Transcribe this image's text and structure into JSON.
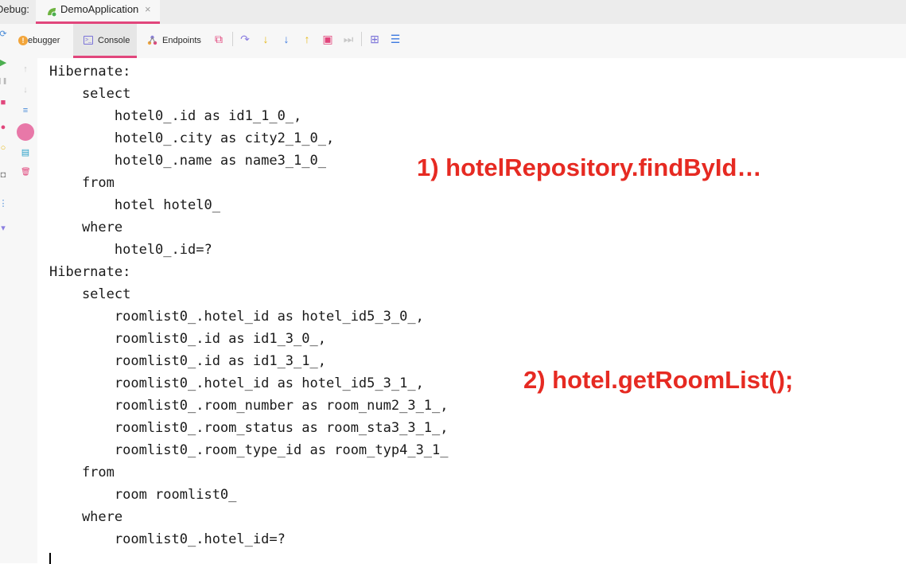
{
  "tabbar": {
    "debug_label": "Debug:",
    "run_tab_title": "DemoApplication",
    "close_glyph": "×",
    "accent_color": "#e1467c"
  },
  "toolbar": {
    "tabs": [
      {
        "label": "Debugger",
        "icon": "debugger-icon",
        "ic_text": "!",
        "rest_text": "ebugger"
      },
      {
        "label": "Console",
        "icon": "console-icon",
        "ic_text": ">_"
      },
      {
        "label": "Endpoints",
        "icon": "endpoints-icon"
      }
    ],
    "buttons": [
      {
        "icon": "restore-layout-icon",
        "glyph": "⧉",
        "color": "#e1467c"
      },
      {
        "icon": "step-over-icon",
        "glyph": "↷",
        "color": "#8b7ee0"
      },
      {
        "icon": "step-into-icon",
        "glyph": "↓",
        "color": "#e5b91a"
      },
      {
        "icon": "force-step-into-icon",
        "glyph": "↓",
        "color": "#3d7ae0"
      },
      {
        "icon": "step-out-icon",
        "glyph": "↑",
        "color": "#e5b91a"
      },
      {
        "icon": "drop-frame-icon",
        "glyph": "▣",
        "color": "#e1467c"
      },
      {
        "icon": "run-to-cursor-icon",
        "glyph": "⏭",
        "color": "#c8c8c8"
      },
      {
        "icon": "evaluate-expression-icon",
        "glyph": "⊞",
        "color": "#7a72d8"
      },
      {
        "icon": "trace-icon",
        "glyph": "☰",
        "color": "#3d7ae0"
      }
    ]
  },
  "gutter": {
    "left": [
      {
        "icon": "rerun-icon",
        "glyph": "⟳",
        "color": "#4a8cd8"
      },
      {
        "icon": "resume-icon",
        "glyph": "▶",
        "color": "#4caf50"
      },
      {
        "icon": "pause-icon",
        "glyph": "❚❚",
        "color": "#b9b9b9"
      },
      {
        "icon": "stop-icon",
        "glyph": "■",
        "color": "#e1467c"
      },
      {
        "icon": "breakpoints-icon",
        "glyph": "●",
        "color": "#e1467c"
      },
      {
        "icon": "mute-breakpoints-icon",
        "glyph": "○",
        "color": "#e5b91a"
      },
      {
        "icon": "camera-icon",
        "glyph": "◘",
        "color": "#8a8a8a"
      },
      {
        "icon": "more-icon",
        "glyph": "⋮",
        "color": "#4a8cd8"
      },
      {
        "icon": "pin-icon",
        "glyph": "▾",
        "color": "#8b7ee0"
      }
    ],
    "right": [
      {
        "icon": "up-arrow-icon",
        "glyph": "↑",
        "color": "#c8c8c8"
      },
      {
        "icon": "down-arrow-icon",
        "glyph": "↓",
        "color": "#c8c8c8"
      },
      {
        "icon": "soft-wrap-icon",
        "glyph": "≡",
        "color": "#4a8cd8"
      },
      {
        "icon": "scroll-to-end-icon",
        "glyph": "●",
        "color": "#e1467c"
      },
      {
        "icon": "print-icon",
        "glyph": "▤",
        "color": "#2aa0c8"
      },
      {
        "icon": "clear-all-icon",
        "glyph": "🗑",
        "color": "#e1467c"
      }
    ]
  },
  "console": {
    "lines": [
      "Hibernate: ",
      "    select",
      "        hotel0_.id as id1_1_0_,",
      "        hotel0_.city as city2_1_0_,",
      "        hotel0_.name as name3_1_0_ ",
      "    from",
      "        hotel hotel0_ ",
      "    where",
      "        hotel0_.id=?",
      "Hibernate: ",
      "    select",
      "        roomlist0_.hotel_id as hotel_id5_3_0_,",
      "        roomlist0_.id as id1_3_0_,",
      "        roomlist0_.id as id1_3_1_,",
      "        roomlist0_.hotel_id as hotel_id5_3_1_,",
      "        roomlist0_.room_number as room_num2_3_1_,",
      "        roomlist0_.room_status as room_sta3_3_1_,",
      "        roomlist0_.room_type_id as room_typ4_3_1_ ",
      "    from",
      "        room roomlist0_ ",
      "    where",
      "        roomlist0_.hotel_id=?"
    ]
  },
  "annotations": [
    {
      "text": "1) hotelRepository.findById…"
    },
    {
      "text": "2) hotel.getRoomList();"
    }
  ]
}
